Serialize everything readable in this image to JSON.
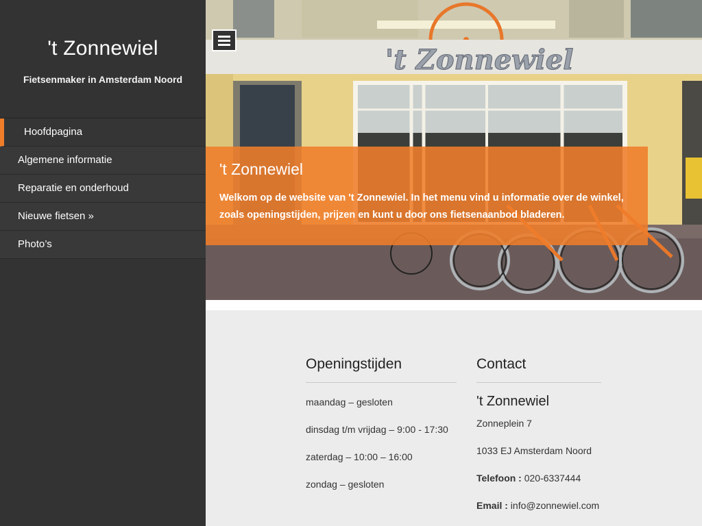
{
  "sidebar": {
    "site_title": "'t Zonnewiel",
    "site_description": "Fietsenmaker in Amsterdam Noord",
    "nav": [
      {
        "label": "Hoofdpagina",
        "active": true
      },
      {
        "label": "Algemene informatie"
      },
      {
        "label": "Reparatie en onderhoud"
      },
      {
        "label": "Nieuwe fietsen »"
      },
      {
        "label": "Photo’s"
      }
    ]
  },
  "hero": {
    "storefront_sign": "'t Zonnewiel",
    "title": "'t Zonnewiel",
    "text": "Welkom op de website van 't Zonnewiel. In het menu vind u informatie over de winkel, zoals openingstijden, prijzen en kunt u door ons fietsenaanbod bladeren."
  },
  "hours": {
    "title": "Openingstijden",
    "lines": [
      "maandag – gesloten",
      "dinsdag t/m vrijdag – 9:00 - 17:30",
      "zaterdag – 10:00 – 16:00",
      "zondag – gesloten"
    ]
  },
  "contact": {
    "title": "Contact",
    "name": "'t Zonnewiel",
    "street": "Zonneplein 7",
    "city": "1033 EJ Amsterdam Noord",
    "phone_label": "Telefoon :",
    "phone": " 020-6337444",
    "email_label": "Email :",
    "email": " info@zonnewiel.com"
  },
  "colors": {
    "accent": "#ef7d2a",
    "sidebar_bg": "#333333",
    "content_bg": "#ececec"
  },
  "icons": {
    "menu_toggle": "hamburger-icon"
  }
}
